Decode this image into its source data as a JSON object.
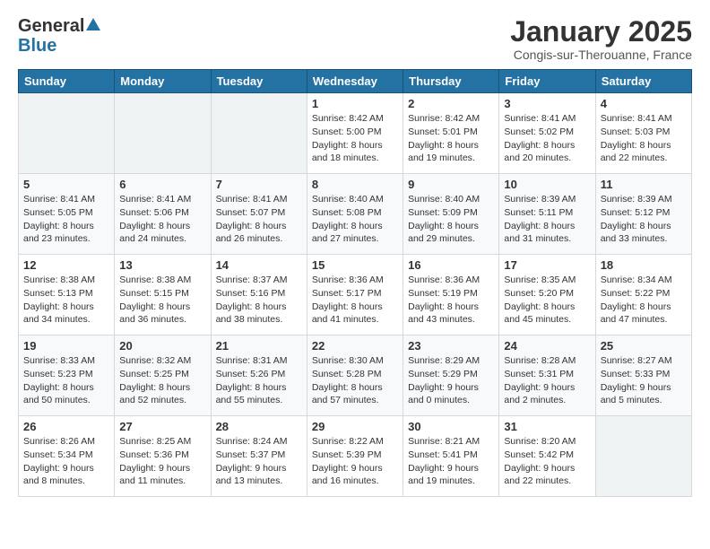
{
  "header": {
    "logo": {
      "general": "General",
      "blue": "Blue"
    },
    "title": "January 2025",
    "subtitle": "Congis-sur-Therouanne, France"
  },
  "weekdays": [
    "Sunday",
    "Monday",
    "Tuesday",
    "Wednesday",
    "Thursday",
    "Friday",
    "Saturday"
  ],
  "weeks": [
    [
      {
        "day": "",
        "info": ""
      },
      {
        "day": "",
        "info": ""
      },
      {
        "day": "",
        "info": ""
      },
      {
        "day": "1",
        "info": "Sunrise: 8:42 AM\nSunset: 5:00 PM\nDaylight: 8 hours\nand 18 minutes."
      },
      {
        "day": "2",
        "info": "Sunrise: 8:42 AM\nSunset: 5:01 PM\nDaylight: 8 hours\nand 19 minutes."
      },
      {
        "day": "3",
        "info": "Sunrise: 8:41 AM\nSunset: 5:02 PM\nDaylight: 8 hours\nand 20 minutes."
      },
      {
        "day": "4",
        "info": "Sunrise: 8:41 AM\nSunset: 5:03 PM\nDaylight: 8 hours\nand 22 minutes."
      }
    ],
    [
      {
        "day": "5",
        "info": "Sunrise: 8:41 AM\nSunset: 5:05 PM\nDaylight: 8 hours\nand 23 minutes."
      },
      {
        "day": "6",
        "info": "Sunrise: 8:41 AM\nSunset: 5:06 PM\nDaylight: 8 hours\nand 24 minutes."
      },
      {
        "day": "7",
        "info": "Sunrise: 8:41 AM\nSunset: 5:07 PM\nDaylight: 8 hours\nand 26 minutes."
      },
      {
        "day": "8",
        "info": "Sunrise: 8:40 AM\nSunset: 5:08 PM\nDaylight: 8 hours\nand 27 minutes."
      },
      {
        "day": "9",
        "info": "Sunrise: 8:40 AM\nSunset: 5:09 PM\nDaylight: 8 hours\nand 29 minutes."
      },
      {
        "day": "10",
        "info": "Sunrise: 8:39 AM\nSunset: 5:11 PM\nDaylight: 8 hours\nand 31 minutes."
      },
      {
        "day": "11",
        "info": "Sunrise: 8:39 AM\nSunset: 5:12 PM\nDaylight: 8 hours\nand 33 minutes."
      }
    ],
    [
      {
        "day": "12",
        "info": "Sunrise: 8:38 AM\nSunset: 5:13 PM\nDaylight: 8 hours\nand 34 minutes."
      },
      {
        "day": "13",
        "info": "Sunrise: 8:38 AM\nSunset: 5:15 PM\nDaylight: 8 hours\nand 36 minutes."
      },
      {
        "day": "14",
        "info": "Sunrise: 8:37 AM\nSunset: 5:16 PM\nDaylight: 8 hours\nand 38 minutes."
      },
      {
        "day": "15",
        "info": "Sunrise: 8:36 AM\nSunset: 5:17 PM\nDaylight: 8 hours\nand 41 minutes."
      },
      {
        "day": "16",
        "info": "Sunrise: 8:36 AM\nSunset: 5:19 PM\nDaylight: 8 hours\nand 43 minutes."
      },
      {
        "day": "17",
        "info": "Sunrise: 8:35 AM\nSunset: 5:20 PM\nDaylight: 8 hours\nand 45 minutes."
      },
      {
        "day": "18",
        "info": "Sunrise: 8:34 AM\nSunset: 5:22 PM\nDaylight: 8 hours\nand 47 minutes."
      }
    ],
    [
      {
        "day": "19",
        "info": "Sunrise: 8:33 AM\nSunset: 5:23 PM\nDaylight: 8 hours\nand 50 minutes."
      },
      {
        "day": "20",
        "info": "Sunrise: 8:32 AM\nSunset: 5:25 PM\nDaylight: 8 hours\nand 52 minutes."
      },
      {
        "day": "21",
        "info": "Sunrise: 8:31 AM\nSunset: 5:26 PM\nDaylight: 8 hours\nand 55 minutes."
      },
      {
        "day": "22",
        "info": "Sunrise: 8:30 AM\nSunset: 5:28 PM\nDaylight: 8 hours\nand 57 minutes."
      },
      {
        "day": "23",
        "info": "Sunrise: 8:29 AM\nSunset: 5:29 PM\nDaylight: 9 hours\nand 0 minutes."
      },
      {
        "day": "24",
        "info": "Sunrise: 8:28 AM\nSunset: 5:31 PM\nDaylight: 9 hours\nand 2 minutes."
      },
      {
        "day": "25",
        "info": "Sunrise: 8:27 AM\nSunset: 5:33 PM\nDaylight: 9 hours\nand 5 minutes."
      }
    ],
    [
      {
        "day": "26",
        "info": "Sunrise: 8:26 AM\nSunset: 5:34 PM\nDaylight: 9 hours\nand 8 minutes."
      },
      {
        "day": "27",
        "info": "Sunrise: 8:25 AM\nSunset: 5:36 PM\nDaylight: 9 hours\nand 11 minutes."
      },
      {
        "day": "28",
        "info": "Sunrise: 8:24 AM\nSunset: 5:37 PM\nDaylight: 9 hours\nand 13 minutes."
      },
      {
        "day": "29",
        "info": "Sunrise: 8:22 AM\nSunset: 5:39 PM\nDaylight: 9 hours\nand 16 minutes."
      },
      {
        "day": "30",
        "info": "Sunrise: 8:21 AM\nSunset: 5:41 PM\nDaylight: 9 hours\nand 19 minutes."
      },
      {
        "day": "31",
        "info": "Sunrise: 8:20 AM\nSunset: 5:42 PM\nDaylight: 9 hours\nand 22 minutes."
      },
      {
        "day": "",
        "info": ""
      }
    ]
  ]
}
